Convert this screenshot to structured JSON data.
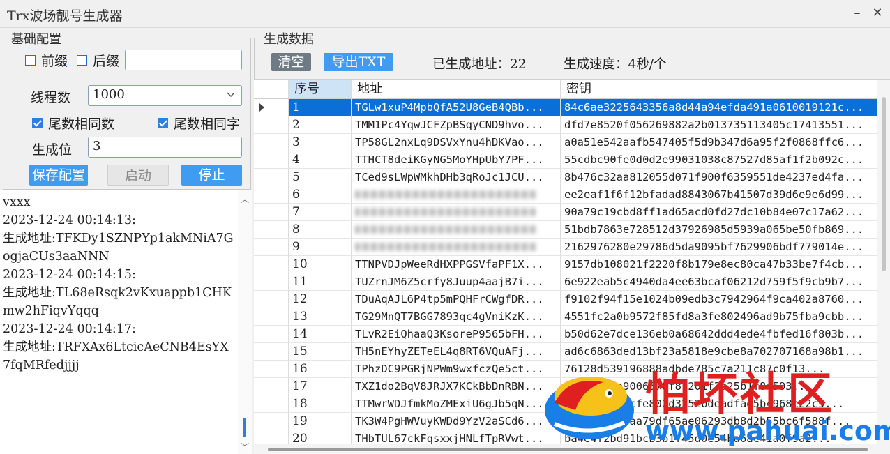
{
  "window": {
    "title": "Trx波场靓号生成器",
    "minimize": "–",
    "close": "✕"
  },
  "config": {
    "group_title": "基础配置",
    "prefix_label": "前缀",
    "suffix_label": "后缀",
    "pattern_value": "",
    "threads_label": "线程数",
    "threads_value": "1000",
    "tail_same_num_label": "尾数相同数",
    "tail_same_char_label": "尾数相同字",
    "gen_bits_label": "生成位",
    "gen_bits_value": "3",
    "save_button": "保存配置",
    "start_button": "启动",
    "stop_button": "停止"
  },
  "log": {
    "lines": [
      "vxxx",
      "2023-12-24 00:14:13:",
      "生成地址:TFKDy1SZNPYp1akMNiA7GogjaCUs3aaNNN",
      "2023-12-24 00:14:15:",
      "生成地址:TL68eRsqk2vKxuappb1CHKmw2hFiqvYqqq",
      "2023-12-24 00:14:17:",
      "生成地址:TRFXAx6LtcicAeCNB4EsYX7fqMRfedjjjj"
    ]
  },
  "data_panel": {
    "group_title": "生成数据",
    "clear_button": "清空",
    "export_button": "导出TXT",
    "generated_count": "已生成地址：22",
    "speed": "生成速度：4秒/个"
  },
  "grid": {
    "columns": [
      "序号",
      "地址",
      "密钥"
    ],
    "rows": [
      [
        "1",
        "TGLw1xuP4MpbQfA52U8GeB4QBb...",
        "84c6ae3225643356a8d44a94efda491a0610019121c..."
      ],
      [
        "2",
        "TMM1Pc4YqwJCFZpBSqyCND9hvo...",
        "dfd7e8520f056269882a2b013735113405c17413551..."
      ],
      [
        "3",
        "TP58GL2nxLq9DSVxYnu4hDKVao...",
        "a0a51e542aafb547405f5d9b347d6a95f2f0868ffc6..."
      ],
      [
        "4",
        "TTHCT8deiKGyNG5MoYHpUbY7PF...",
        "55cdbc90fe0d0d2e99031038c87527d85af1f2b092c..."
      ],
      [
        "5",
        "TCed9sLWpWMkhDHb3qRoJc1JCU...",
        "8b476c32aa812055d071f900f6359551de4237ed4fa..."
      ],
      [
        "6",
        "",
        "ee2eaf1f6f12bfadad8843067b41507d39d6e9e6d99..."
      ],
      [
        "7",
        "",
        "90a79c19cbd8ff1ad65acd0fd27dc10b84e07c17a62..."
      ],
      [
        "8",
        "",
        "51bdb7863e728512d37926985d5939a065be50fb869..."
      ],
      [
        "9",
        "",
        "2162976280e29786d5da9095bf7629906bdf779014e..."
      ],
      [
        "10",
        "TTNPVDJpWeeRdHXPPGSVfaPF1X...",
        "9157db108021f2220f8b179e8ec80ca47b33be7f4cb..."
      ],
      [
        "11",
        "TUZrnJM6Z5crfy8Juup4aajB7i...",
        "6e922eab5c4940da4ee63bcaf06212d759f5f9cb9b7..."
      ],
      [
        "12",
        "TDuAqAJL6P4tp5mPQHFrCWgfDR...",
        "f9102f94f15e1024b09edb3c7942964f9ca402a8760..."
      ],
      [
        "13",
        "TG29MnQT7BGG7893qc4gVniKzK...",
        "4551fc2a0b9572f85fd8a3fe802496ad9b75fba9cbb..."
      ],
      [
        "14",
        "TLvR2EiQhaaQ3KsoreP9565bFH...",
        "b50d62e7dce136eb0a68642ddd4ede4fbfed16f803b..."
      ],
      [
        "15",
        "TH5nEYhyZETeEL4q8RT6VQuAFj...",
        "ad6c6863ded13bf23a5818e9cbe8a702707168a98b1..."
      ],
      [
        "16",
        "TPhzDC9PGRjNPWm9wxfczQe5ct...",
        "76128d539196888adbde785c7a211c87c0f13..."
      ],
      [
        "17",
        "TXZ1do2BqV8JRJX7KCkBbDnRBN...",
        "fa3d3ef9a9006578f81201f3a25b1f8f593..."
      ],
      [
        "18",
        "TTMwrWDJfmkMoZMExiU6gJb5qN...",
        "c1dd9aa06ocfe802d3252bdeadfad5b4968c22c9..."
      ],
      [
        "19",
        "TK3W4PgHWVuyKWDd9YzV2aSCd6...",
        "2139f42c87aa79df65ae06293db8d2b55bc6f588f..."
      ],
      [
        "20",
        "THbTUL67ckFqsxxjHNLfTpRVwt...",
        "ba4e4f2bd91bcb3b1f45d0e54ba6ac41a0f9a2..."
      ]
    ]
  },
  "watermark": {
    "name": "怕坏社区",
    "url": "www.pahuai.com"
  },
  "colors": {
    "accent": "#3f9cf0",
    "selection": "#0a6fd6",
    "watermark_red": "#e02020",
    "watermark_blue": "#1a7ee8"
  }
}
